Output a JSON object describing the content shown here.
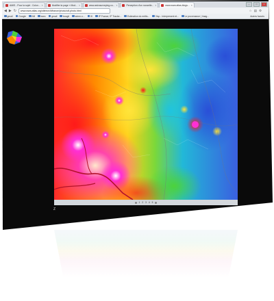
{
  "browser": {
    "tabs": [
      {
        "title": "AMIS - Pour la sujet : Colon..."
      },
      {
        "title": "Modifier la page « Mod..."
      },
      {
        "title": "www.astrosurveying.co..."
      },
      {
        "title": "Perception d'un nouvelle..."
      },
      {
        "title": "www.www.atlas-blogs..."
      }
    ],
    "window_controls": {
      "minimize": "–",
      "maximize": "□",
      "close": "×"
    },
    "url": "www.www.atlas.org/siteeon/idfrance/photo/cdf-photo.html",
    "bookmarks": [
      {
        "label": "gmail"
      },
      {
        "label": "Google"
      },
      {
        "label": "AB"
      },
      {
        "label": "avec"
      },
      {
        "label": "gmail"
      },
      {
        "label": "bougit"
      },
      {
        "label": "sdmn.o..."
      },
      {
        "label": "IK"
      },
      {
        "label": "IP France, IP Tracke..."
      },
      {
        "label": "Estimation du métis..."
      },
      {
        "label": "Visp - Interpresent et..."
      },
      {
        "label": "Le provenance | Imag..."
      }
    ],
    "bookmarks_other": "Autres favoris"
  },
  "map_footer": {
    "labels": [
      "1",
      "2",
      "3",
      "4",
      "5"
    ]
  },
  "status_glyph": "Z",
  "colors": {
    "hot": "#ff1a1a",
    "warm": "#ff8a00",
    "mid": "#ffd11a",
    "green": "#4cd23c",
    "cool": "#22b8d8",
    "cold": "#3a5fe0",
    "peak": "#ff2fd5"
  }
}
